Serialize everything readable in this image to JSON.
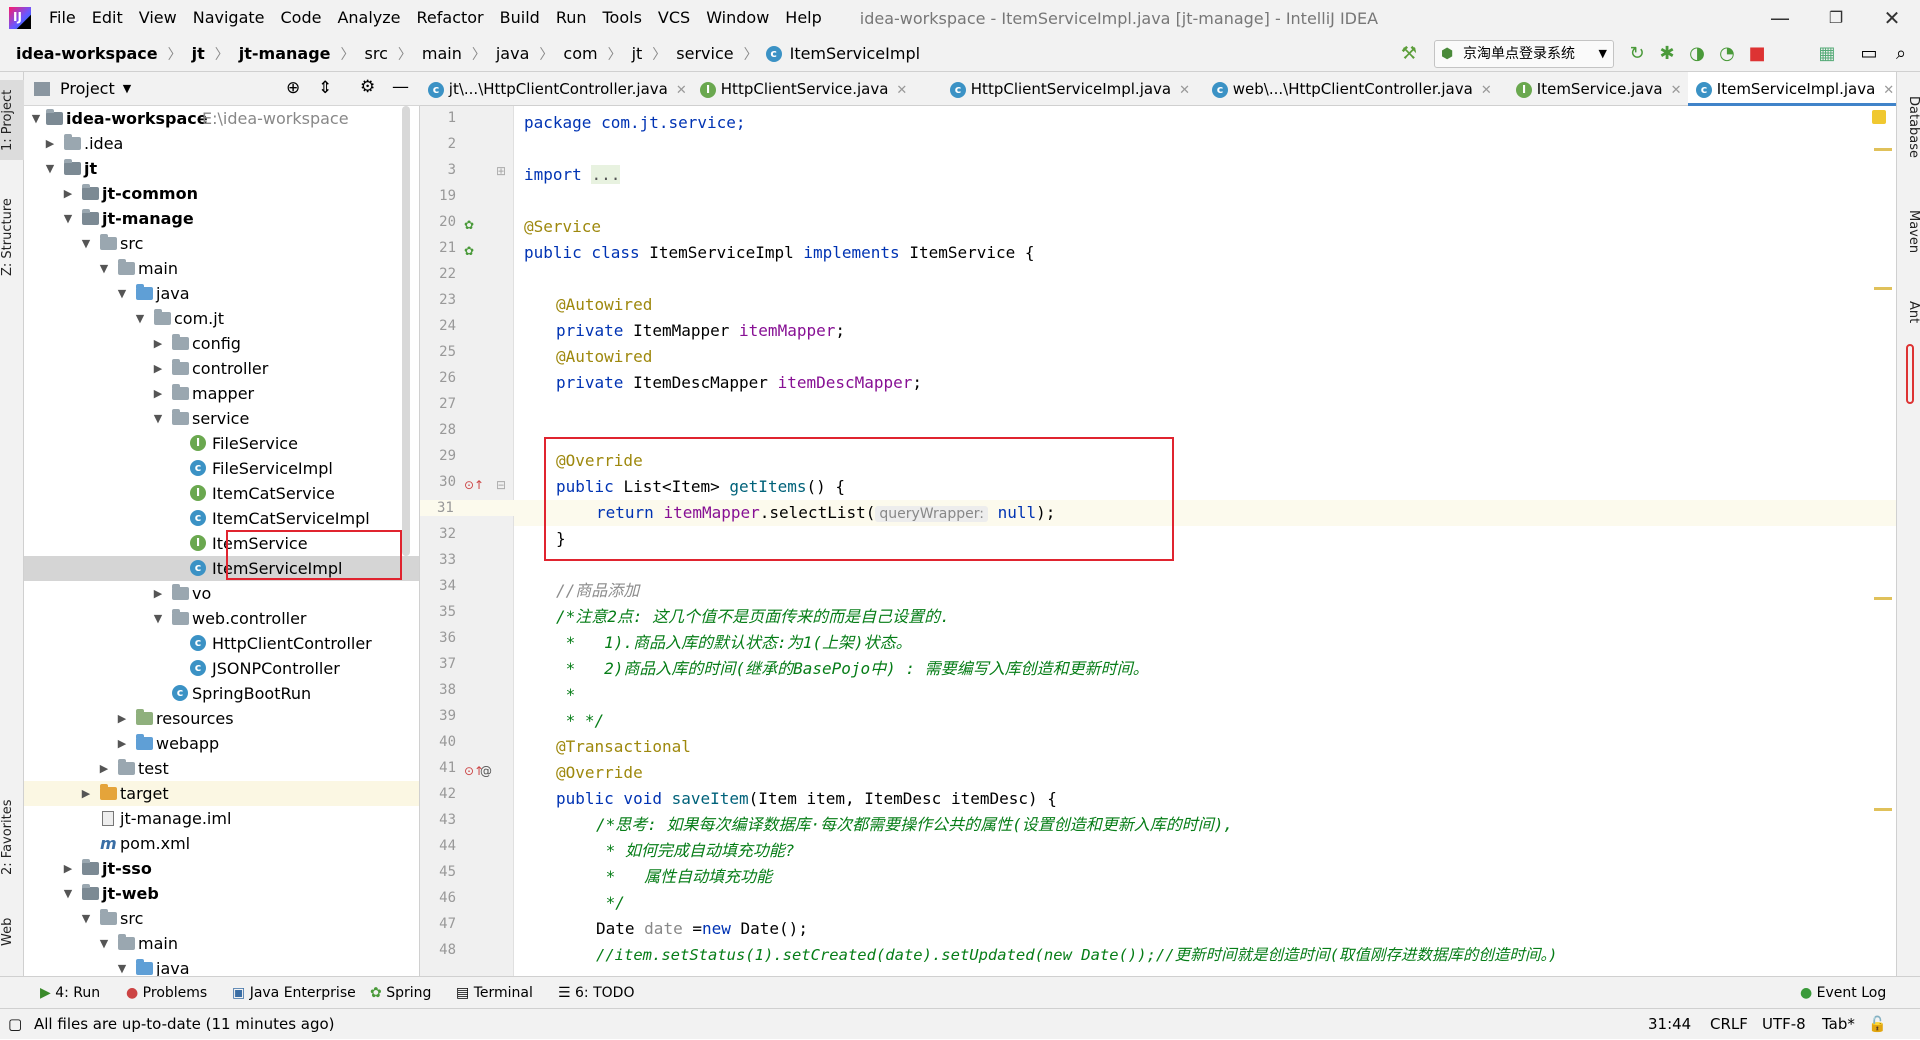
{
  "menubar": {
    "items": [
      "File",
      "Edit",
      "View",
      "Navigate",
      "Code",
      "Analyze",
      "Refactor",
      "Build",
      "Run",
      "Tools",
      "VCS",
      "Window",
      "Help"
    ],
    "title": "idea-workspace - ItemServiceImpl.java [jt-manage] - IntelliJ IDEA"
  },
  "navbar": {
    "crumbs": [
      "idea-workspace",
      "jt",
      "jt-manage",
      "src",
      "main",
      "java",
      "com",
      "jt",
      "service",
      "ItemServiceImpl"
    ],
    "run_config": "京淘单点登录系统"
  },
  "left_strip": {
    "project": "1: Project",
    "structure": "Z: Structure",
    "favorites": "2: Favorites",
    "web": "Web"
  },
  "right_strip": {
    "database": "Database",
    "maven": "Maven",
    "ant": "Ant"
  },
  "project_panel": {
    "title": "Project"
  },
  "tree": [
    {
      "label": "idea-workspace",
      "extra": "E:\\idea-workspace"
    },
    {
      "label": ".idea"
    },
    {
      "label": "jt"
    },
    {
      "label": "jt-common"
    },
    {
      "label": "jt-manage"
    },
    {
      "label": "src"
    },
    {
      "label": "main"
    },
    {
      "label": "java"
    },
    {
      "label": "com.jt"
    },
    {
      "label": "config"
    },
    {
      "label": "controller"
    },
    {
      "label": "mapper"
    },
    {
      "label": "service"
    },
    {
      "label": "FileService"
    },
    {
      "label": "FileServiceImpl"
    },
    {
      "label": "ItemCatService"
    },
    {
      "label": "ItemCatServiceImpl"
    },
    {
      "label": "ItemService"
    },
    {
      "label": "ItemServiceImpl"
    },
    {
      "label": "vo"
    },
    {
      "label": "web.controller"
    },
    {
      "label": "HttpClientController"
    },
    {
      "label": "JSONPController"
    },
    {
      "label": "SpringBootRun"
    },
    {
      "label": "resources"
    },
    {
      "label": "webapp"
    },
    {
      "label": "test"
    },
    {
      "label": "target"
    },
    {
      "label": "jt-manage.iml"
    },
    {
      "label": "pom.xml"
    },
    {
      "label": "jt-sso"
    },
    {
      "label": "jt-web"
    },
    {
      "label": "src"
    },
    {
      "label": "main"
    },
    {
      "label": "java"
    }
  ],
  "tabs": [
    "jt\\...\\HttpClientController.java",
    "HttpClientService.java",
    "HttpClientServiceImpl.java",
    "web\\...\\HttpClientController.java",
    "ItemService.java",
    "ItemServiceImpl.java"
  ],
  "line_numbers": [
    "1",
    "2",
    "3",
    "19",
    "20",
    "21",
    "22",
    "23",
    "24",
    "25",
    "26",
    "27",
    "28",
    "29",
    "30",
    "31",
    "32",
    "33",
    "34",
    "35",
    "36",
    "37",
    "38",
    "39",
    "40",
    "41",
    "42",
    "43",
    "44",
    "45",
    "46",
    "47",
    "48"
  ],
  "code": {
    "l1": "package com.jt.service;",
    "l3a": "import ",
    "l3b": "...",
    "l20": "@Service",
    "l21a": "public class ",
    "l21b": "ItemServiceImpl ",
    "l21c": "implements ",
    "l21d": "ItemService {",
    "l23": "@Autowired",
    "l24a": "private ",
    "l24b": "ItemMapper ",
    "l24c": "itemMapper",
    "l24d": ";",
    "l25": "@Autowired",
    "l26a": "private ",
    "l26b": "ItemDescMapper ",
    "l26c": "itemDescMapper",
    "l26d": ";",
    "l29": "@Override",
    "l30a": "public ",
    "l30b": "List<Item> ",
    "l30c": "getItems",
    "l30d": "() {",
    "l31a": "return ",
    "l31b": "itemMapper",
    "l31c": ".selectList(",
    "l31hint": "queryWrapper:",
    "l31d": "null",
    "l31e": ");",
    "l32": "}",
    "l34": "//商品添加",
    "l35": "/*注意2点: 这几个值不是页面传来的而是自己设置的.",
    "l36": " *   1).商品入库的默认状态:为1(上架)状态。",
    "l37": " *   2)商品入库的时间(继承的BasePojo中) : 需要编写入库创造和更新时间。",
    "l38": " *",
    "l39": " * */",
    "l40": "@Transactional",
    "l41": "@Override",
    "l42a": "public void ",
    "l42b": "saveItem",
    "l42c": "(Item item, ItemDesc itemDesc) {",
    "l43": "/*思考: 如果每次编译数据库·每次都需要操作公共的属性(设置创造和更新入库的时间),",
    "l44": " * 如何完成自动填充功能?",
    "l45": " *   属性自动填充功能",
    "l46": " */",
    "l47a": "Date ",
    "l47b": "date ",
    "l47c": "=",
    "l47d": "new ",
    "l47e": "Date();",
    "l48": "//item.setStatus(1).setCreated(date).setUpdated(new Date());//更新时间就是创造时间(取值刚存进数据库的创造时间。)"
  },
  "bottom_tabs": [
    "4: Run",
    "Problems",
    "Java Enterprise",
    "Spring",
    "Terminal",
    "6: TODO",
    "Event Log"
  ],
  "status": {
    "message": "All files are up-to-date (11 minutes ago)",
    "position": "31:44",
    "line_sep": "CRLF",
    "encoding": "UTF-8",
    "indent": "Tab*"
  },
  "colors": {
    "accent": "#4083c9",
    "highlight_box": "#e0242f",
    "keyword": "#0033b3",
    "annotation": "#9e880d",
    "field": "#871094",
    "comment": "#067d17"
  }
}
